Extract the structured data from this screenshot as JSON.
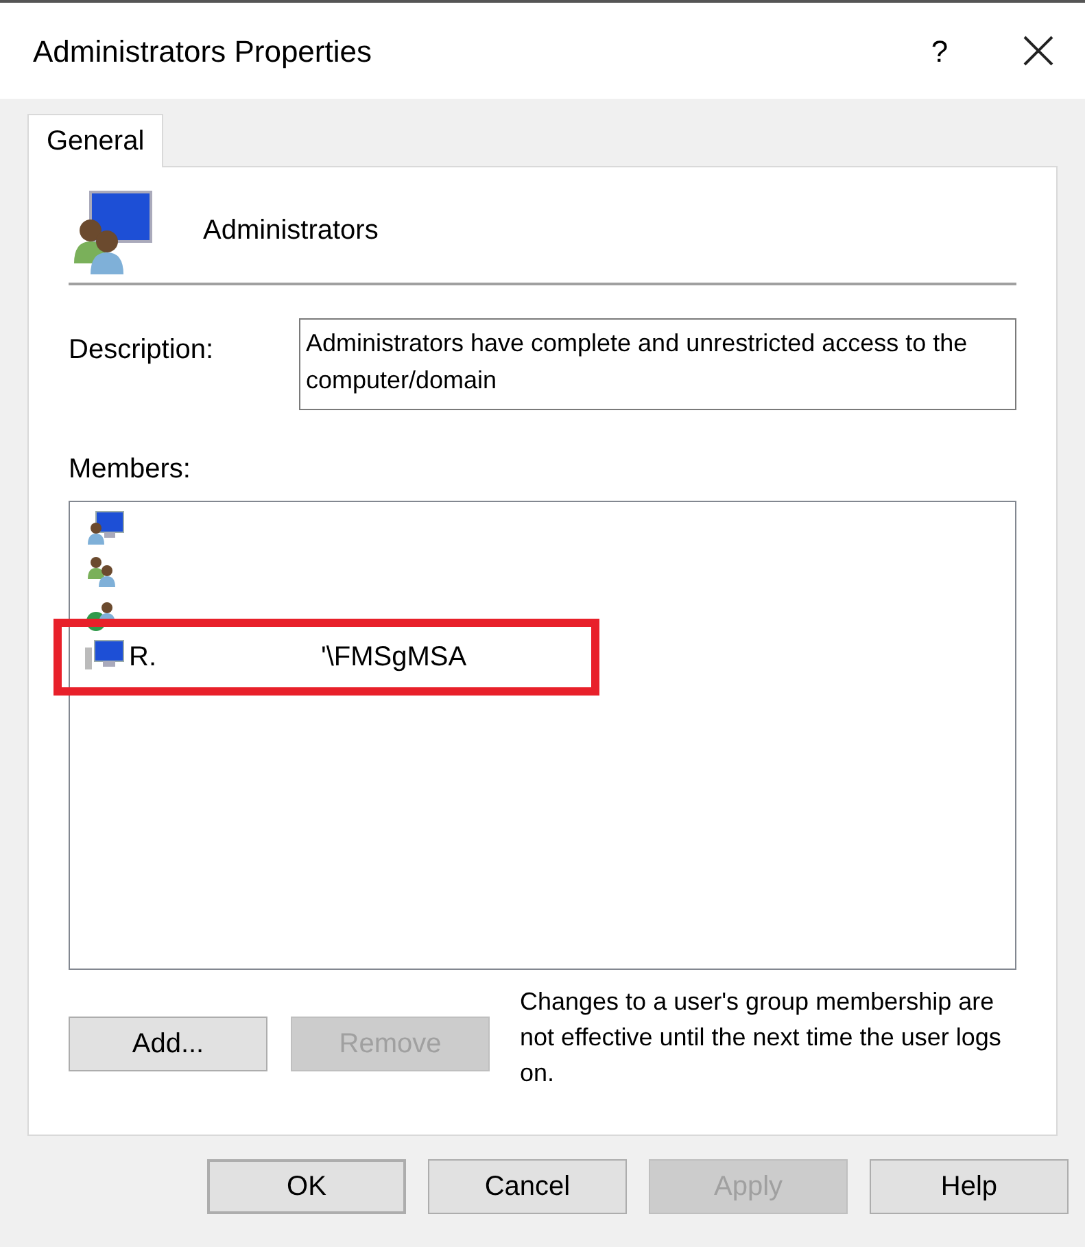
{
  "window": {
    "title": "Administrators Properties",
    "help_button": "?"
  },
  "tabs": [
    {
      "label": "General",
      "selected": true
    }
  ],
  "group": {
    "name": "Administrators"
  },
  "description": {
    "label": "Description:",
    "value": "Administrators have complete and unrestricted access to the computer/domain"
  },
  "members": {
    "label": "Members:",
    "items": [
      {
        "kind": "user-computer",
        "highlighted": false
      },
      {
        "kind": "group",
        "highlighted": false
      },
      {
        "kind": "globe-user",
        "highlighted": false
      },
      {
        "kind": "computer",
        "texts": [
          "R.",
          "'\\FMSgMSA"
        ],
        "highlighted": true
      }
    ]
  },
  "member_buttons": [
    {
      "label": "Add...",
      "disabled": false,
      "default": false
    },
    {
      "label": "Remove",
      "disabled": true,
      "default": false
    }
  ],
  "note": "Changes to a user's group membership are not effective until the next time the user logs on.",
  "buttons": [
    {
      "label": "OK",
      "disabled": false,
      "default": true
    },
    {
      "label": "Cancel",
      "disabled": false,
      "default": false
    },
    {
      "label": "Apply",
      "disabled": true,
      "default": false
    },
    {
      "label": "Help",
      "disabled": false,
      "default": false
    }
  ]
}
